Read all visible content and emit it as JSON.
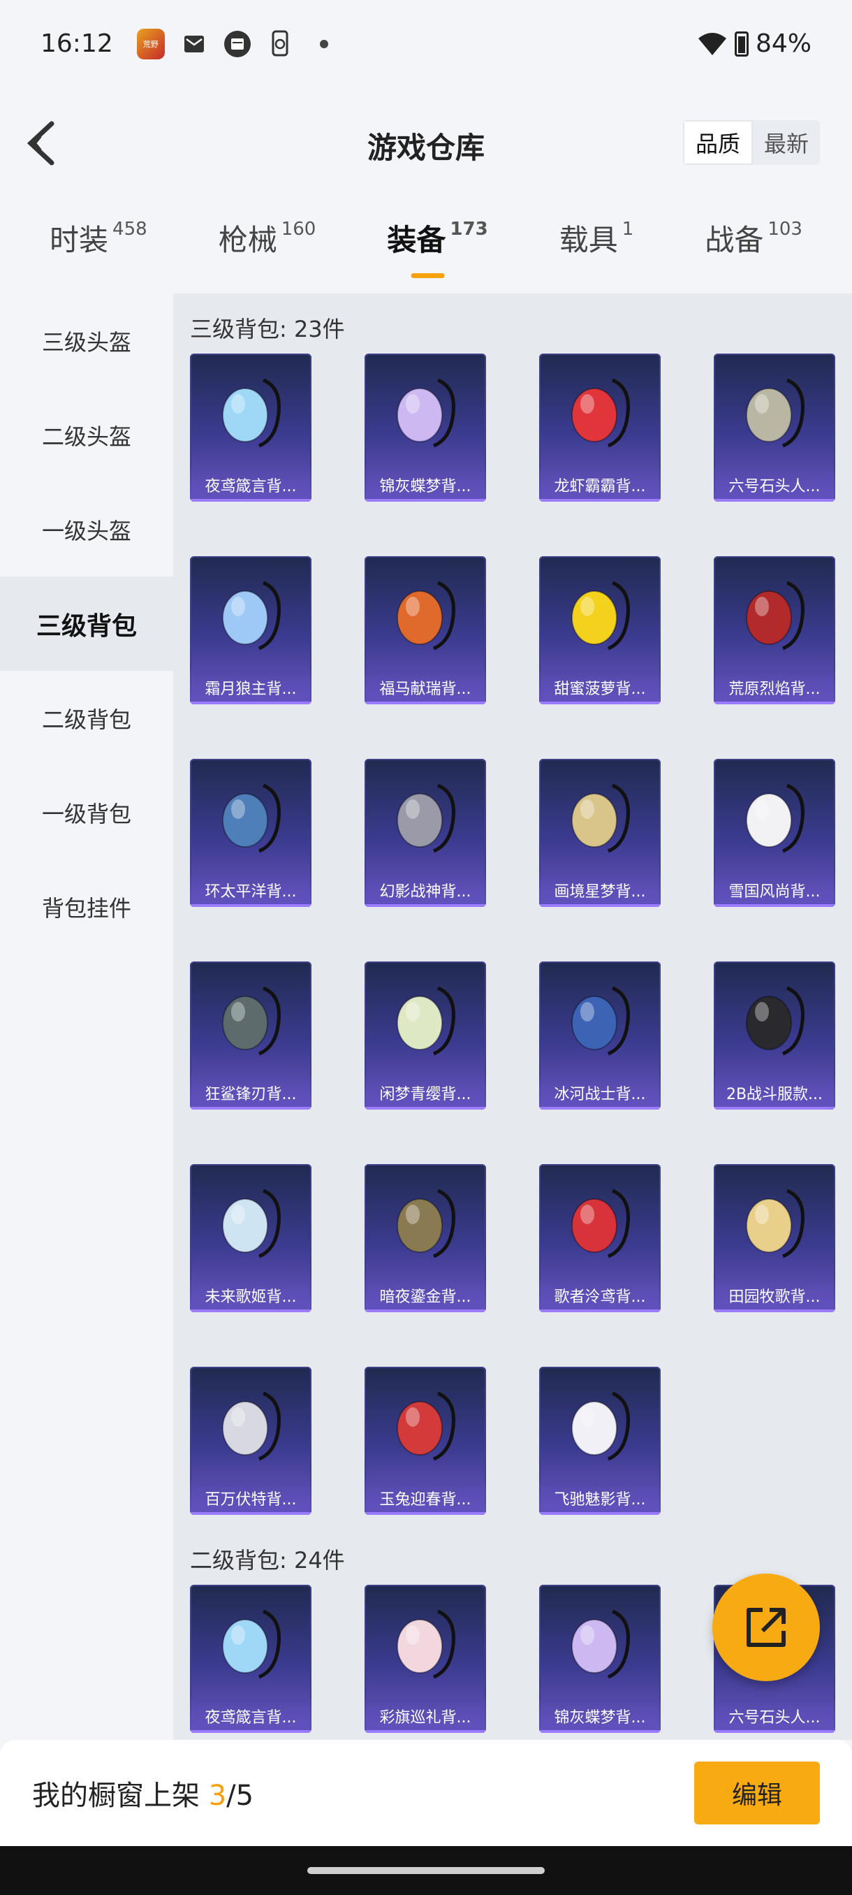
{
  "status_bar": {
    "time": "16:12",
    "app_badge_text": "荒野",
    "icons": [
      "game-app-icon",
      "mail-icon",
      "calendar-icon",
      "phone-sync-icon",
      "dot-icon"
    ],
    "battery": "84%"
  },
  "header": {
    "title": "游戏仓库",
    "sort_options": [
      "品质",
      "最新"
    ],
    "active_sort": "品质"
  },
  "tabs": [
    {
      "label": "时装",
      "count": "458"
    },
    {
      "label": "枪械",
      "count": "160"
    },
    {
      "label": "装备",
      "count": "173",
      "active": true
    },
    {
      "label": "载具",
      "count": "1"
    },
    {
      "label": "战备",
      "count": "103"
    }
  ],
  "sidebar": {
    "items": [
      "三级头盔",
      "二级头盔",
      "一级头盔",
      "三级背包",
      "二级背包",
      "一级背包",
      "背包挂件"
    ],
    "active": "三级背包"
  },
  "sections": [
    {
      "title": "三级背包: 23件",
      "items": [
        {
          "name": "夜鸢箴言背...",
          "icon": "jellyfish-backpack-icon",
          "color": "#9fd8f7"
        },
        {
          "name": "锦灰蝶梦背...",
          "icon": "crystal-backpack-icon",
          "color": "#cdb8f2"
        },
        {
          "name": "龙虾霸霸背...",
          "icon": "lobster-backpack-icon",
          "color": "#e0353a"
        },
        {
          "name": "六号石头人...",
          "icon": "stone-golem-backpack-icon",
          "color": "#b9b7a4"
        },
        {
          "name": "霜月狼主背...",
          "icon": "frost-orb-backpack-icon",
          "color": "#9ec8f5"
        },
        {
          "name": "福马献瑞背...",
          "icon": "horse-backpack-icon",
          "color": "#e06a2c"
        },
        {
          "name": "甜蜜菠萝背...",
          "icon": "pineapple-backpack-icon",
          "color": "#f2d21c"
        },
        {
          "name": "荒原烈焰背...",
          "icon": "flame-backpack-icon",
          "color": "#b32a2a"
        },
        {
          "name": "环太平洋背...",
          "icon": "mech-backpack-icon",
          "color": "#4f7fb8"
        },
        {
          "name": "幻影战神背...",
          "icon": "phantom-backpack-icon",
          "color": "#9a9aa8"
        },
        {
          "name": "画境星梦背...",
          "icon": "starry-frame-backpack-icon",
          "color": "#d9c48a"
        },
        {
          "name": "雪国风尚背...",
          "icon": "penguin-backpack-icon",
          "color": "#f2f2f5"
        },
        {
          "name": "狂鲨锋刃背...",
          "icon": "shark-backpack-icon",
          "color": "#5d6b6c"
        },
        {
          "name": "闲梦青缨背...",
          "icon": "lantern-backpack-icon",
          "color": "#dfe8c4"
        },
        {
          "name": "冰河战士背...",
          "icon": "blue-backpack-icon",
          "color": "#3d63b5"
        },
        {
          "name": "2B战斗服款...",
          "icon": "black-backpack-icon",
          "color": "#2a2a2e"
        },
        {
          "name": "未来歌姬背...",
          "icon": "singer-backpack-icon",
          "color": "#cfe4f2"
        },
        {
          "name": "暗夜鎏金背...",
          "icon": "gold-armor-backpack-icon",
          "color": "#8a7a52"
        },
        {
          "name": "歌者泠鸢背...",
          "icon": "red-pouch-backpack-icon",
          "color": "#d8323a"
        },
        {
          "name": "田园牧歌背...",
          "icon": "flower-basket-backpack-icon",
          "color": "#e8d08a"
        },
        {
          "name": "百万伏特背...",
          "icon": "robot-backpack-icon",
          "color": "#d8d8e2"
        },
        {
          "name": "玉兔迎春背...",
          "icon": "rabbit-backpack-icon",
          "color": "#d33a3a"
        },
        {
          "name": "飞驰魅影背...",
          "icon": "racer-backpack-icon",
          "color": "#f0f0f6"
        }
      ]
    },
    {
      "title": "二级背包: 24件",
      "items": [
        {
          "name": "夜鸢箴言背...",
          "icon": "jellyfish-backpack-icon",
          "color": "#9fd8f7"
        },
        {
          "name": "彩旗巡礼背...",
          "icon": "flag-backpack-icon",
          "color": "#f2d7df"
        },
        {
          "name": "锦灰蝶梦背...",
          "icon": "crystal-backpack-icon",
          "color": "#cdb8f2"
        },
        {
          "name": "六号石头人...",
          "icon": "stone-golem-backpack-icon",
          "color": "#b9b7a4"
        }
      ]
    }
  ],
  "footer": {
    "label": "我的橱窗上架",
    "count": "3",
    "total": "/5",
    "edit_button": "编辑"
  },
  "share_button_icon": "share-icon"
}
